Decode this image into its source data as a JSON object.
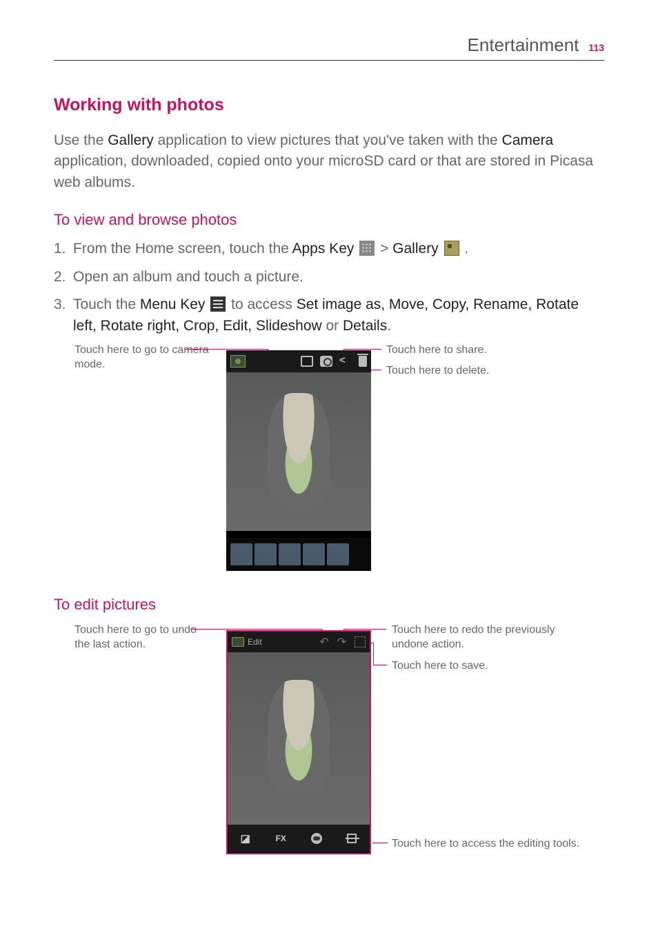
{
  "header": {
    "section": "Entertainment",
    "pageNum": "113"
  },
  "h2": "Working with photos",
  "intro_parts": {
    "p1": "Use the ",
    "gallery": "Gallery",
    "p2": " application to view pictures that you've taken with the ",
    "camera": "Camera",
    "p3": " application, downloaded, copied onto your microSD card or that are stored in Picasa web albums."
  },
  "h3a": "To view and browse photos",
  "steps": {
    "s1": {
      "num": "1.",
      "a": "From the Home screen, touch the ",
      "apps": "Apps Key",
      "gt": " > ",
      "gal": "Gallery",
      "end": " ."
    },
    "s2": {
      "num": "2.",
      "text": "Open an album and touch a picture."
    },
    "s3": {
      "num": "3.",
      "a": "Touch the ",
      "menu": "Menu Key",
      "b": " to access ",
      "opts": "Set image as, Move, Copy, Rename, Rotate left, Rotate right, Crop, Edit, Slideshow",
      "or": " or ",
      "details": "Details",
      "end": "."
    }
  },
  "fig1_callouts": {
    "left": "Touch here to go to camera mode.",
    "right1": "Touch here to share.",
    "right2": "Touch here to delete."
  },
  "h3b": "To edit pictures",
  "fig2_callouts": {
    "left": "Touch here to go to undo the last action.",
    "right1": "Touch here to redo the previously undone action.",
    "right2": "Touch here to save.",
    "right3": "Touch here to access the editing tools."
  },
  "edit_label": "Edit",
  "fx_label": "FX"
}
